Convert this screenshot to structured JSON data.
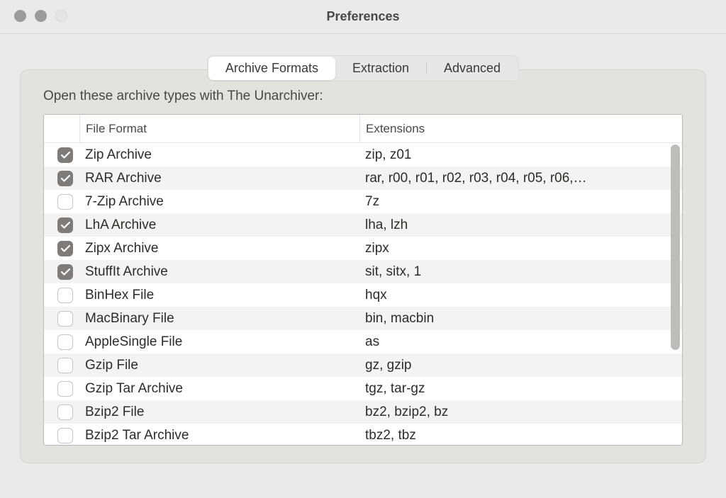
{
  "window": {
    "title": "Preferences"
  },
  "tabs": {
    "items": [
      {
        "label": "Archive Formats",
        "active": true
      },
      {
        "label": "Extraction",
        "active": false
      },
      {
        "label": "Advanced",
        "active": false
      }
    ]
  },
  "subtitle": "Open these archive types with The Unarchiver:",
  "columns": {
    "format": "File Format",
    "extensions": "Extensions"
  },
  "rows": [
    {
      "checked": true,
      "format": "Zip Archive",
      "extensions": "zip, z01"
    },
    {
      "checked": true,
      "format": "RAR Archive",
      "extensions": "rar, r00, r01, r02, r03, r04, r05, r06,…"
    },
    {
      "checked": false,
      "format": "7-Zip Archive",
      "extensions": "7z"
    },
    {
      "checked": true,
      "format": "LhA Archive",
      "extensions": "lha, lzh"
    },
    {
      "checked": true,
      "format": "Zipx Archive",
      "extensions": "zipx"
    },
    {
      "checked": true,
      "format": "StuffIt Archive",
      "extensions": "sit, sitx, 1"
    },
    {
      "checked": false,
      "format": "BinHex File",
      "extensions": "hqx"
    },
    {
      "checked": false,
      "format": "MacBinary File",
      "extensions": "bin, macbin"
    },
    {
      "checked": false,
      "format": "AppleSingle File",
      "extensions": "as"
    },
    {
      "checked": false,
      "format": "Gzip File",
      "extensions": "gz, gzip"
    },
    {
      "checked": false,
      "format": "Gzip Tar Archive",
      "extensions": "tgz, tar-gz"
    },
    {
      "checked": false,
      "format": "Bzip2 File",
      "extensions": "bz2, bzip2, bz"
    },
    {
      "checked": false,
      "format": "Bzip2 Tar Archive",
      "extensions": "tbz2, tbz"
    }
  ]
}
